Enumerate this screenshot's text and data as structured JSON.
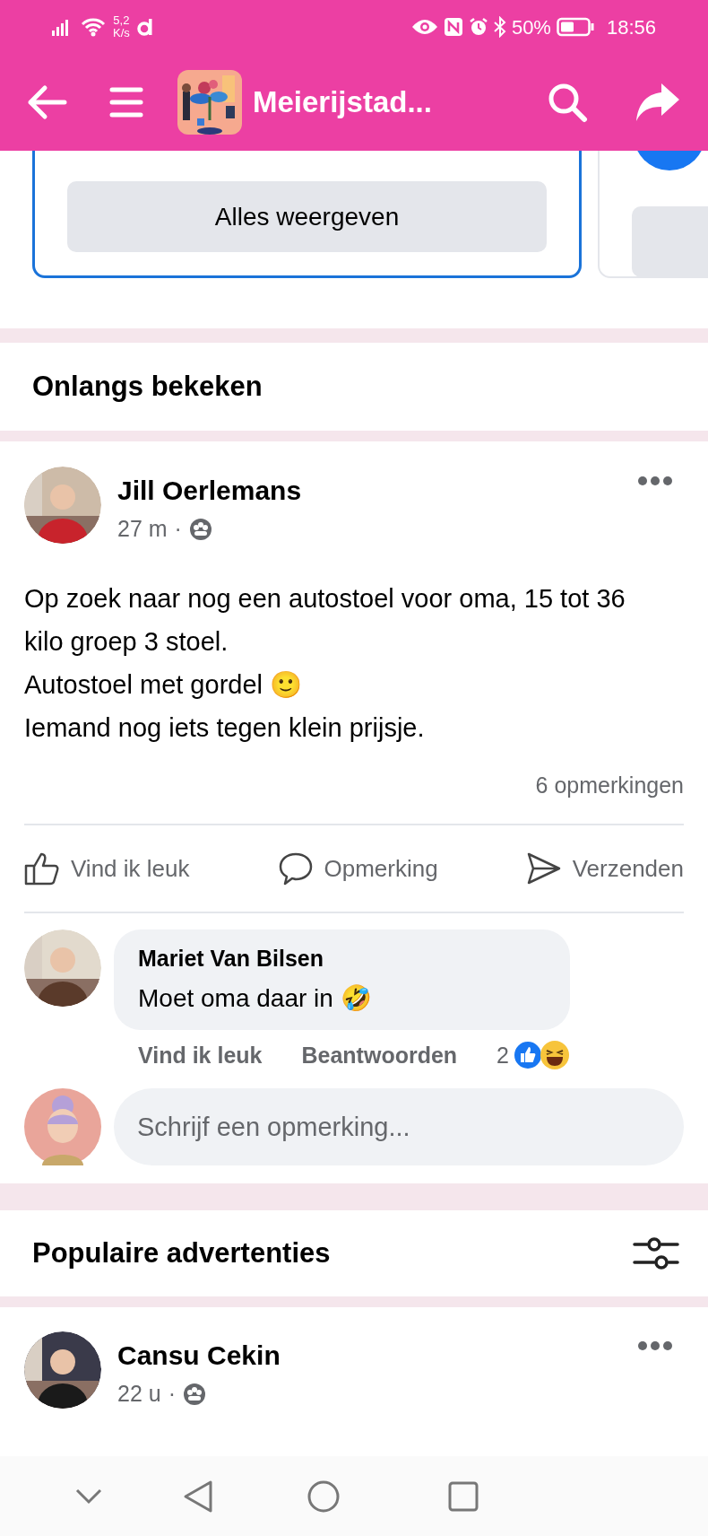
{
  "status_bar": {
    "speed": "5,2",
    "speed_unit": "K/s",
    "battery": "50%",
    "time": "18:56"
  },
  "app_bar": {
    "title": "Meierijstad..."
  },
  "top_card": {
    "button": "Alles weergeven"
  },
  "recently_viewed": {
    "title": "Onlangs bekeken",
    "post": {
      "author": "Jill Oerlemans",
      "time": "27 m",
      "separator": "·",
      "lines": [
        "Op zoek naar nog een autostoel voor oma, 15 tot 36 kilo groep 3 stoel.",
        "Autostoel met gordel 🙂",
        "Iemand nog iets tegen klein prijsje."
      ],
      "comments_count": "6 opmerkingen",
      "actions": [
        {
          "kind": "like",
          "label": "Vind ik leuk"
        },
        {
          "kind": "comment",
          "label": "Opmerking"
        },
        {
          "kind": "send",
          "label": "Verzenden"
        }
      ],
      "comment": {
        "author": "Mariet Van Bilsen",
        "text": "Moet oma daar in 🤣",
        "like": "Vind ik leuk",
        "reply": "Beantwoorden",
        "reaction_count": "2"
      },
      "write_placeholder": "Schrijf een opmerking..."
    }
  },
  "popular": {
    "title": "Populaire advertenties",
    "post": {
      "author": "Cansu Cekin",
      "time": "22 u",
      "separator": "·"
    }
  }
}
